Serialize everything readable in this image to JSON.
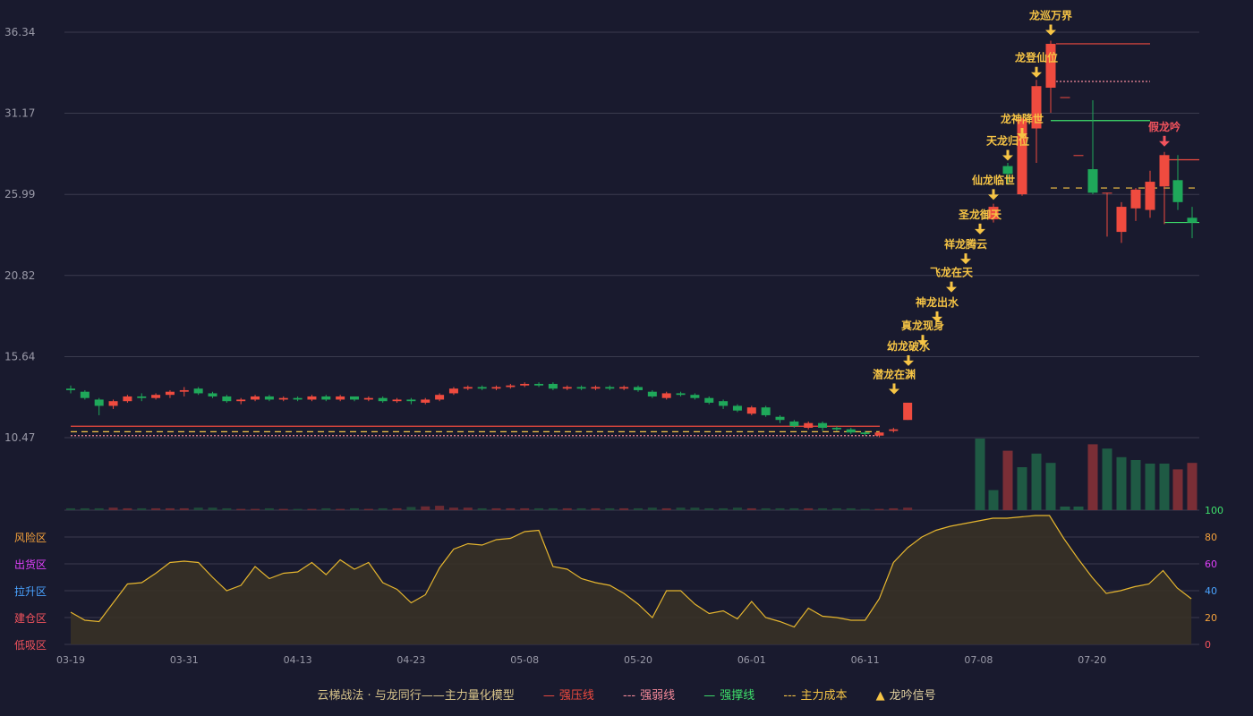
{
  "chart_data": {
    "type": "candlestick",
    "price_axis": {
      "ticks": [
        "36.34",
        "31.17",
        "25.99",
        "20.82",
        "15.64",
        "10.47"
      ],
      "ylim": [
        10.47,
        36.34
      ]
    },
    "x_ticks": [
      {
        "i": 0,
        "label": "03-19"
      },
      {
        "i": 8,
        "label": "03-31"
      },
      {
        "i": 16,
        "label": "04-13"
      },
      {
        "i": 24,
        "label": "04-23"
      },
      {
        "i": 32,
        "label": "05-08"
      },
      {
        "i": 40,
        "label": "05-20"
      },
      {
        "i": 48,
        "label": "06-01"
      },
      {
        "i": 56,
        "label": "06-11"
      },
      {
        "i": 64,
        "label": "07-08"
      },
      {
        "i": 72,
        "label": "07-20"
      }
    ],
    "candles": [
      [
        13.6,
        13.5,
        13.8,
        13.3
      ],
      [
        13.4,
        13.0,
        13.5,
        12.9
      ],
      [
        12.9,
        12.5,
        13.0,
        11.9
      ],
      [
        12.5,
        12.8,
        12.9,
        12.3
      ],
      [
        12.8,
        13.1,
        13.2,
        12.7
      ],
      [
        13.1,
        13.0,
        13.3,
        12.8
      ],
      [
        13.0,
        13.2,
        13.3,
        12.9
      ],
      [
        13.2,
        13.4,
        13.5,
        13.0
      ],
      [
        13.4,
        13.5,
        13.7,
        13.1
      ],
      [
        13.6,
        13.3,
        13.7,
        13.2
      ],
      [
        13.3,
        13.1,
        13.4,
        13.0
      ],
      [
        13.1,
        12.8,
        13.2,
        12.7
      ],
      [
        12.8,
        12.9,
        13.0,
        12.6
      ],
      [
        12.9,
        13.1,
        13.2,
        12.8
      ],
      [
        13.1,
        12.9,
        13.2,
        12.8
      ],
      [
        12.9,
        13.0,
        13.1,
        12.8
      ],
      [
        13.0,
        12.9,
        13.1,
        12.8
      ],
      [
        12.9,
        13.1,
        13.2,
        12.8
      ],
      [
        13.1,
        12.9,
        13.2,
        12.8
      ],
      [
        12.9,
        13.1,
        13.2,
        12.8
      ],
      [
        13.1,
        12.9,
        13.1,
        12.8
      ],
      [
        12.9,
        13.0,
        13.1,
        12.8
      ],
      [
        13.0,
        12.8,
        13.1,
        12.7
      ],
      [
        12.8,
        12.9,
        13.0,
        12.7
      ],
      [
        12.9,
        12.8,
        13.0,
        12.6
      ],
      [
        12.7,
        12.9,
        13.0,
        12.6
      ],
      [
        12.9,
        13.2,
        13.3,
        12.8
      ],
      [
        13.3,
        13.6,
        13.7,
        13.2
      ],
      [
        13.6,
        13.7,
        13.8,
        13.5
      ],
      [
        13.7,
        13.6,
        13.8,
        13.5
      ],
      [
        13.6,
        13.7,
        13.8,
        13.5
      ],
      [
        13.7,
        13.8,
        13.9,
        13.6
      ],
      [
        13.8,
        13.9,
        14.0,
        13.7
      ],
      [
        13.9,
        13.8,
        14.0,
        13.7
      ],
      [
        13.9,
        13.6,
        14.0,
        13.5
      ],
      [
        13.6,
        13.7,
        13.8,
        13.5
      ],
      [
        13.7,
        13.6,
        13.8,
        13.5
      ],
      [
        13.6,
        13.7,
        13.8,
        13.5
      ],
      [
        13.7,
        13.6,
        13.8,
        13.5
      ],
      [
        13.6,
        13.7,
        13.8,
        13.5
      ],
      [
        13.7,
        13.5,
        13.8,
        13.4
      ],
      [
        13.4,
        13.1,
        13.5,
        13.0
      ],
      [
        13.0,
        13.3,
        13.4,
        12.9
      ],
      [
        13.3,
        13.2,
        13.4,
        13.1
      ],
      [
        13.2,
        13.0,
        13.3,
        12.9
      ],
      [
        13.0,
        12.7,
        13.1,
        12.6
      ],
      [
        12.8,
        12.5,
        12.9,
        12.3
      ],
      [
        12.5,
        12.2,
        12.6,
        12.1
      ],
      [
        12.0,
        12.4,
        12.5,
        11.9
      ],
      [
        12.4,
        11.9,
        12.5,
        11.8
      ],
      [
        11.8,
        11.6,
        11.9,
        11.4
      ],
      [
        11.5,
        11.2,
        11.6,
        11.1
      ],
      [
        11.1,
        11.4,
        11.5,
        11.0
      ],
      [
        11.4,
        11.1,
        11.5,
        10.9
      ],
      [
        11.1,
        11.0,
        11.2,
        10.9
      ],
      [
        11.0,
        10.8,
        11.1,
        10.7
      ],
      [
        10.8,
        10.7,
        10.9,
        10.6
      ],
      [
        10.6,
        10.8,
        10.9,
        10.5
      ],
      [
        10.9,
        11.0,
        11.1,
        10.8
      ],
      [
        11.6,
        12.7,
        12.7,
        11.6
      ],
      [
        null,
        null,
        null,
        null
      ],
      [
        null,
        null,
        null,
        null
      ],
      [
        null,
        null,
        null,
        null
      ],
      [
        null,
        null,
        null,
        null
      ],
      [
        null,
        null,
        null,
        null
      ],
      [
        null,
        null,
        null,
        null
      ],
      [
        null,
        null,
        null,
        null
      ],
      [
        null,
        null,
        null,
        null
      ],
      [
        null,
        null,
        null,
        null
      ],
      [
        null,
        null,
        null,
        null
      ],
      [
        null,
        null,
        null,
        null
      ],
      [
        null,
        null,
        null,
        null
      ],
      [
        null,
        null,
        null,
        null
      ],
      [
        null,
        null,
        null,
        null
      ],
      [
        null,
        null,
        null,
        null
      ],
      [
        null,
        null,
        null,
        null
      ]
    ],
    "tail_candles": [
      {
        "x": 1110,
        "o": 24.4,
        "c": 25.2,
        "h": 25.4,
        "l": 24.2
      },
      {
        "x": 1126,
        "o": 27.8,
        "c": 27.3,
        "h": 28.0,
        "l": 26.6
      },
      {
        "x": 1142,
        "o": 26.0,
        "c": 30.8,
        "h": 30.9,
        "l": 25.9
      },
      {
        "x": 1158,
        "o": 30.2,
        "c": 32.9,
        "h": 33.3,
        "l": 28.0
      },
      {
        "x": 1174,
        "o": 32.8,
        "c": 35.6,
        "h": 35.8,
        "l": 31.2
      },
      {
        "x": 1190,
        "o": 32.2,
        "c": 32.2,
        "h": 32.2,
        "l": 32.2
      },
      {
        "x": 1205,
        "o": 28.5,
        "c": 28.5,
        "h": 28.5,
        "l": 28.5
      },
      {
        "x": 1221,
        "o": 27.6,
        "c": 26.1,
        "h": 32.0,
        "l": 26.0
      },
      {
        "x": 1237,
        "o": 26.1,
        "c": 26.1,
        "h": 26.1,
        "l": 23.3
      },
      {
        "x": 1253,
        "o": 23.6,
        "c": 25.2,
        "h": 25.5,
        "l": 22.9
      },
      {
        "x": 1269,
        "o": 25.1,
        "c": 26.3,
        "h": 26.4,
        "l": 24.3
      },
      {
        "x": 1285,
        "o": 25.0,
        "c": 26.8,
        "h": 27.5,
        "l": 24.5
      },
      {
        "x": 1301,
        "o": 26.5,
        "c": 28.5,
        "h": 28.7,
        "l": 24.1
      },
      {
        "x": 1316,
        "o": 26.9,
        "c": 25.5,
        "h": 28.5,
        "l": 25.0
      },
      {
        "x": 1332,
        "o": 24.5,
        "c": 24.2,
        "h": 25.2,
        "l": 23.2
      }
    ],
    "levels": [
      {
        "name": "强压线",
        "y": 11.2,
        "x0": 79,
        "x1": 983,
        "color": "#ef4b3f",
        "dash": ""
      },
      {
        "name": "强弱线",
        "y": 10.6,
        "x0": 79,
        "x1": 983,
        "color": "#f58a9a",
        "dash": "2,2"
      },
      {
        "name": "主力成本",
        "y": 10.85,
        "x0": 79,
        "x1": 983,
        "color": "#f6c445",
        "dash": "7,5"
      },
      {
        "name": "强压线",
        "y": 35.6,
        "x0": 1180,
        "x1": 1285,
        "color": "#ef4b3f",
        "dash": ""
      },
      {
        "name": "强弱线",
        "y": 33.2,
        "x0": 1180,
        "x1": 1285,
        "color": "#f58a9a",
        "dash": "2,2"
      },
      {
        "name": "强撑线",
        "y": 30.7,
        "x0": 1174,
        "x1": 1285,
        "color": "#3ee06b",
        "dash": ""
      },
      {
        "name": "主力成本",
        "y": 26.4,
        "x0": 1174,
        "x1": 1340,
        "color": "#f6c445",
        "dash": "7,7"
      },
      {
        "name": "强压线",
        "y": 28.2,
        "x0": 1301,
        "x1": 1340,
        "color": "#ef4b3f",
        "dash": ""
      },
      {
        "name": "强撑线",
        "y": 24.2,
        "x0": 1301,
        "x1": 1340,
        "color": "#3ee06b",
        "dash": ""
      }
    ],
    "signals": [
      {
        "x": 999,
        "y": 12.9,
        "label": "潜龙在渊",
        "color": "#f6c445"
      },
      {
        "x": 1015,
        "y": 14.7,
        "label": "幼龙破水",
        "color": "#f6c445"
      },
      {
        "x": 1031,
        "y": 16.0,
        "label": "真龙现身",
        "color": "#f6c445"
      },
      {
        "x": 1047,
        "y": 17.5,
        "label": "神龙出水",
        "color": "#f6c445"
      },
      {
        "x": 1063,
        "y": 19.4,
        "label": "飞龙在天",
        "color": "#f6c445"
      },
      {
        "x": 1079,
        "y": 21.2,
        "label": "祥龙腾云",
        "color": "#f6c445"
      },
      {
        "x": 1095,
        "y": 23.1,
        "label": "圣龙御天",
        "color": "#f6c445"
      },
      {
        "x": 1110,
        "y": 25.3,
        "label": "仙龙临世",
        "color": "#f6c445"
      },
      {
        "x": 1126,
        "y": 27.8,
        "label": "天龙归位",
        "color": "#f6c445"
      },
      {
        "x": 1142,
        "y": 29.2,
        "label": "龙神降世",
        "color": "#f6c445"
      },
      {
        "x": 1158,
        "y": 33.1,
        "label": "龙登仙位",
        "color": "#f6c445"
      },
      {
        "x": 1174,
        "y": 35.8,
        "label": "龙巡万界",
        "color": "#f6c445"
      },
      {
        "x": 1301,
        "y": 28.7,
        "label": "假龙吟",
        "color": "#f2535d"
      }
    ],
    "volume": [
      3,
      3,
      3,
      4,
      3,
      3,
      3,
      3,
      3,
      4,
      4,
      3,
      2,
      2,
      3,
      2,
      2,
      2,
      3,
      2,
      3,
      2,
      3,
      3,
      5,
      6,
      7,
      4,
      4,
      3,
      3,
      3,
      3,
      3,
      3,
      3,
      3,
      3,
      3,
      3,
      3,
      4,
      3,
      4,
      4,
      3,
      3,
      4,
      3,
      3,
      3,
      3,
      3,
      3,
      3,
      3,
      2,
      2,
      3,
      4,
      0,
      0,
      0,
      0,
      0,
      0,
      0,
      0,
      0,
      0,
      0,
      0,
      0,
      0,
      0,
      0
    ],
    "tail_volume": [
      {
        "x": 1095,
        "v": 100,
        "up": false
      },
      {
        "x": 1110,
        "v": 28,
        "up": false
      },
      {
        "x": 1126,
        "v": 83,
        "up": true
      },
      {
        "x": 1142,
        "v": 60,
        "up": false
      },
      {
        "x": 1158,
        "v": 79,
        "up": false
      },
      {
        "x": 1174,
        "v": 66,
        "up": false
      },
      {
        "x": 1190,
        "v": 5,
        "up": false
      },
      {
        "x": 1205,
        "v": 5,
        "up": false
      },
      {
        "x": 1221,
        "v": 92,
        "up": true
      },
      {
        "x": 1237,
        "v": 86,
        "up": false
      },
      {
        "x": 1253,
        "v": 74,
        "up": false
      },
      {
        "x": 1269,
        "v": 70,
        "up": false
      },
      {
        "x": 1285,
        "v": 65,
        "up": false
      },
      {
        "x": 1301,
        "v": 65,
        "up": false
      },
      {
        "x": 1316,
        "v": 57,
        "up": true
      },
      {
        "x": 1332,
        "v": 66,
        "up": true
      }
    ],
    "indicator": {
      "ylim": [
        0,
        100
      ],
      "right_ticks": [
        {
          "v": 100,
          "label": "100",
          "color": "#3ee06b"
        },
        {
          "v": 80,
          "label": "80",
          "color": "#f6a23b"
        },
        {
          "v": 60,
          "label": "60",
          "color": "#e040fb"
        },
        {
          "v": 40,
          "label": "40",
          "color": "#4aa3ff"
        },
        {
          "v": 20,
          "label": "20",
          "color": "#f6a23b"
        },
        {
          "v": 0,
          "label": "0",
          "color": "#f2535d"
        }
      ],
      "zones": [
        {
          "v": 80,
          "label": "风险区",
          "color": "#f6a23b"
        },
        {
          "v": 60,
          "label": "出货区",
          "color": "#e040fb"
        },
        {
          "v": 40,
          "label": "拉升区",
          "color": "#4aa3ff"
        },
        {
          "v": 20,
          "label": "建仓区",
          "color": "#f2535d"
        },
        {
          "v": 0,
          "label": "低吸区",
          "color": "#f2535d"
        }
      ],
      "values": [
        24,
        18,
        17,
        31,
        45,
        46,
        53,
        61,
        62,
        61,
        50,
        40,
        44,
        58,
        49,
        53,
        54,
        61,
        52,
        63,
        56,
        61,
        46,
        41,
        31,
        37,
        57,
        71,
        75,
        74,
        78,
        79,
        84,
        85,
        58,
        56,
        49,
        46,
        44,
        38,
        30,
        20,
        40,
        40,
        30,
        23,
        25,
        19,
        32,
        20,
        17,
        13,
        27,
        21,
        20,
        18,
        18,
        34,
        61,
        72,
        80,
        85,
        88,
        90,
        92,
        94,
        94,
        95,
        96,
        96,
        79,
        64,
        50,
        38,
        40,
        43,
        45,
        55,
        42,
        34
      ]
    },
    "legend": [
      {
        "label": "云梯战法 · 与龙同行——主力量化模型",
        "symbol": "",
        "color": "#d8c48a"
      },
      {
        "label": "强压线",
        "symbol": "—",
        "color": "#ef4b3f"
      },
      {
        "label": "强弱线",
        "symbol": "---",
        "color": "#f58a9a"
      },
      {
        "label": "强撑线",
        "symbol": "—",
        "color": "#3ee06b"
      },
      {
        "label": "主力成本",
        "symbol": "---",
        "color": "#f6c445"
      },
      {
        "label": "龙吟信号",
        "symbol": "▲",
        "color": "#f6c445"
      }
    ],
    "colors": {
      "up": "#ef4b3f",
      "down": "#1fa85a",
      "grid": "#3a3b4e",
      "axis_text": "#9a9aa8"
    }
  }
}
